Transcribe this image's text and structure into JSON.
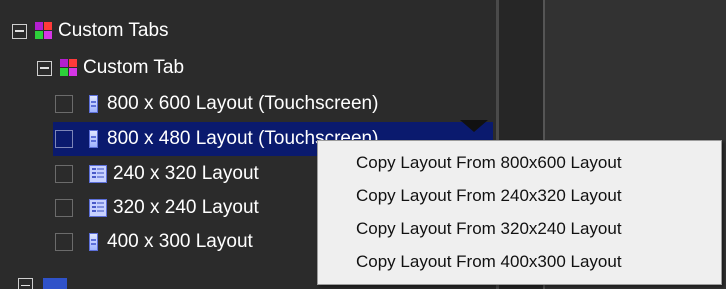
{
  "tree": {
    "root": {
      "label": "Custom Tabs",
      "icon": "custom-tabs-icon"
    },
    "child": {
      "label": "Custom Tab",
      "icon": "custom-tabs-icon"
    },
    "layouts": [
      {
        "label": "800 x 600 Layout (Touchscreen)",
        "icon": "layout-page-icon",
        "selected": false
      },
      {
        "label": "800 x 480 Layout (Touchscreen)",
        "icon": "layout-page-icon",
        "selected": true
      },
      {
        "label": "240 x 320 Layout",
        "icon": "layout-list-icon",
        "selected": false
      },
      {
        "label": "320 x 240 Layout",
        "icon": "layout-list-icon",
        "selected": false
      },
      {
        "label": "400 x 300 Layout",
        "icon": "layout-page-icon",
        "selected": false
      }
    ]
  },
  "context_menu": {
    "items": [
      "Copy Layout From 800x600 Layout",
      "Copy Layout From 240x320 Layout",
      "Copy Layout From 320x240 Layout",
      "Copy Layout From 400x300 Layout"
    ]
  },
  "colors": {
    "background": "#2b2b2b",
    "selection": "#0a1a6e",
    "menu_background": "#efefef"
  }
}
